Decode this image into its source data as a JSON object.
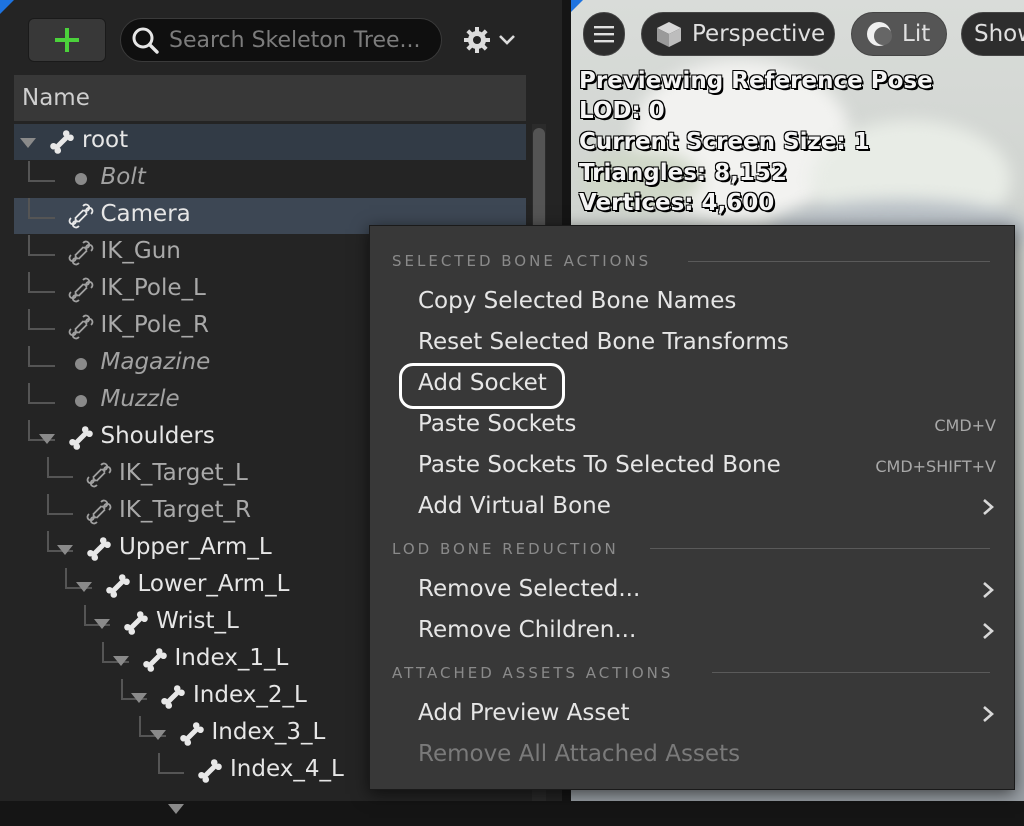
{
  "skeleton_tree": {
    "search_placeholder": "Search Skeleton Tree...",
    "column_header": "Name",
    "icons": {
      "add": "plus-icon",
      "search": "search-icon",
      "settings": "gear-icon",
      "settings_menu": "chevron-down-icon"
    },
    "bones": [
      {
        "label": "root",
        "kind": "bone",
        "style": "bright",
        "row_state": "root"
      },
      {
        "label": "Bolt",
        "kind": "socket",
        "style": "italic"
      },
      {
        "label": "Camera",
        "kind": "virtual",
        "style": "bright",
        "row_state": "selected"
      },
      {
        "label": "IK_Gun",
        "kind": "virtual",
        "style": "grey"
      },
      {
        "label": "IK_Pole_L",
        "kind": "virtual",
        "style": "grey"
      },
      {
        "label": "IK_Pole_R",
        "kind": "virtual",
        "style": "grey"
      },
      {
        "label": "Magazine",
        "kind": "socket",
        "style": "italic"
      },
      {
        "label": "Muzzle",
        "kind": "socket",
        "style": "italic"
      },
      {
        "label": "Shoulders",
        "kind": "bone",
        "style": "bright"
      },
      {
        "label": "IK_Target_L",
        "kind": "virtual",
        "style": "grey"
      },
      {
        "label": "IK_Target_R",
        "kind": "virtual",
        "style": "grey"
      },
      {
        "label": "Upper_Arm_L",
        "kind": "bone",
        "style": "bright"
      },
      {
        "label": "Lower_Arm_L",
        "kind": "bone",
        "style": "bright"
      },
      {
        "label": "Wrist_L",
        "kind": "bone",
        "style": "bright"
      },
      {
        "label": "Index_1_L",
        "kind": "bone",
        "style": "bright"
      },
      {
        "label": "Index_2_L",
        "kind": "bone",
        "style": "bright"
      },
      {
        "label": "Index_3_L",
        "kind": "bone",
        "style": "bright"
      },
      {
        "label": "Index_4_L",
        "kind": "bone",
        "style": "bright"
      }
    ]
  },
  "viewport": {
    "menu_icon": "hamburger-icon",
    "perspective_label": "Perspective",
    "lit_label": "Lit",
    "show_label": "Show",
    "overlay": [
      "Previewing Reference Pose",
      "LOD: 0",
      "Current Screen Size: 1",
      "Triangles: 8,152",
      "Vertices: 4,600"
    ]
  },
  "context_menu": {
    "sections": [
      {
        "title": "SELECTED BONE ACTIONS",
        "items": [
          {
            "label": "Copy Selected Bone Names"
          },
          {
            "label": "Reset Selected Bone Transforms"
          },
          {
            "label": "Add Socket",
            "highlighted": true
          },
          {
            "label": "Paste Sockets",
            "shortcut": "CMD+V"
          },
          {
            "label": "Paste Sockets To Selected Bone",
            "shortcut": "CMD+SHIFT+V"
          },
          {
            "label": "Add Virtual Bone",
            "submenu": true
          }
        ]
      },
      {
        "title": "LOD BONE REDUCTION",
        "items": [
          {
            "label": "Remove Selected...",
            "submenu": true
          },
          {
            "label": "Remove Children...",
            "submenu": true
          }
        ]
      },
      {
        "title": "ATTACHED ASSETS ACTIONS",
        "items": [
          {
            "label": "Add Preview Asset",
            "submenu": true
          },
          {
            "label": "Remove All Attached Assets",
            "disabled": true
          }
        ]
      }
    ]
  },
  "colors": {
    "accent_blue": "#1d73e0",
    "add_green": "#4bd23b",
    "selected_row": "#3d4754",
    "menu_bg": "#383838"
  }
}
